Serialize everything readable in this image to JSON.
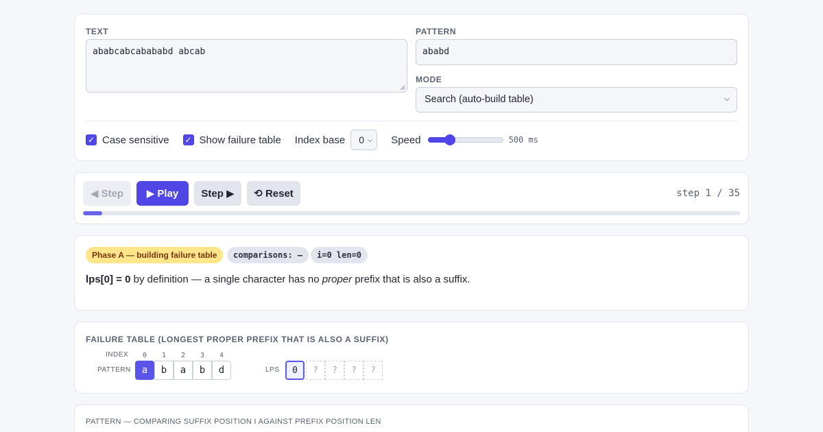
{
  "settings": {
    "text_label": "TEXT",
    "text_value": "ababcabcabababd abcab",
    "pattern_label": "PATTERN",
    "pattern_value": "ababd",
    "mode_label": "MODE",
    "mode_value": "Search (auto-build table)",
    "case_sensitive_label": "Case sensitive",
    "case_sensitive_checked": true,
    "show_failure_label": "Show failure table",
    "show_failure_checked": true,
    "index_base_label": "Index base",
    "index_base_value": "0",
    "speed_label": "Speed",
    "speed_value": "500 ms",
    "speed_fraction": 0.26,
    "accent_color": "#4f46e5"
  },
  "controls": {
    "back_label": "◀ Step",
    "play_label": "▶ Play",
    "step_label": "Step ▶",
    "reset_label": "⟲ Reset",
    "step_text": "step 1 / 35",
    "progress_fraction": 0.029
  },
  "status": {
    "phase": "Phase A — building failure table",
    "comparisons": "comparisons: —",
    "indices": "i=0 len=0",
    "explain_bold": "lps[0] = 0",
    "explain_mid": " by definition — a single character has no ",
    "explain_italic": "proper",
    "explain_end": " prefix that is also a suffix."
  },
  "failure_table": {
    "title": "FAILURE TABLE (LONGEST PROPER PREFIX THAT IS ALSO A SUFFIX)",
    "index_label": "INDEX",
    "pattern_label": "PATTERN",
    "lps_label": "LPS",
    "indices": [
      "0",
      "1",
      "2",
      "3",
      "4"
    ],
    "pattern_chars": [
      "a",
      "b",
      "a",
      "b",
      "d"
    ],
    "lps_values": [
      "0",
      "?",
      "?",
      "?",
      "?"
    ],
    "highlight_color": "#5b54e8"
  },
  "compare": {
    "title": "PATTERN — COMPARING SUFFIX POSITION I AGAINST PREFIX POSITION LEN"
  }
}
